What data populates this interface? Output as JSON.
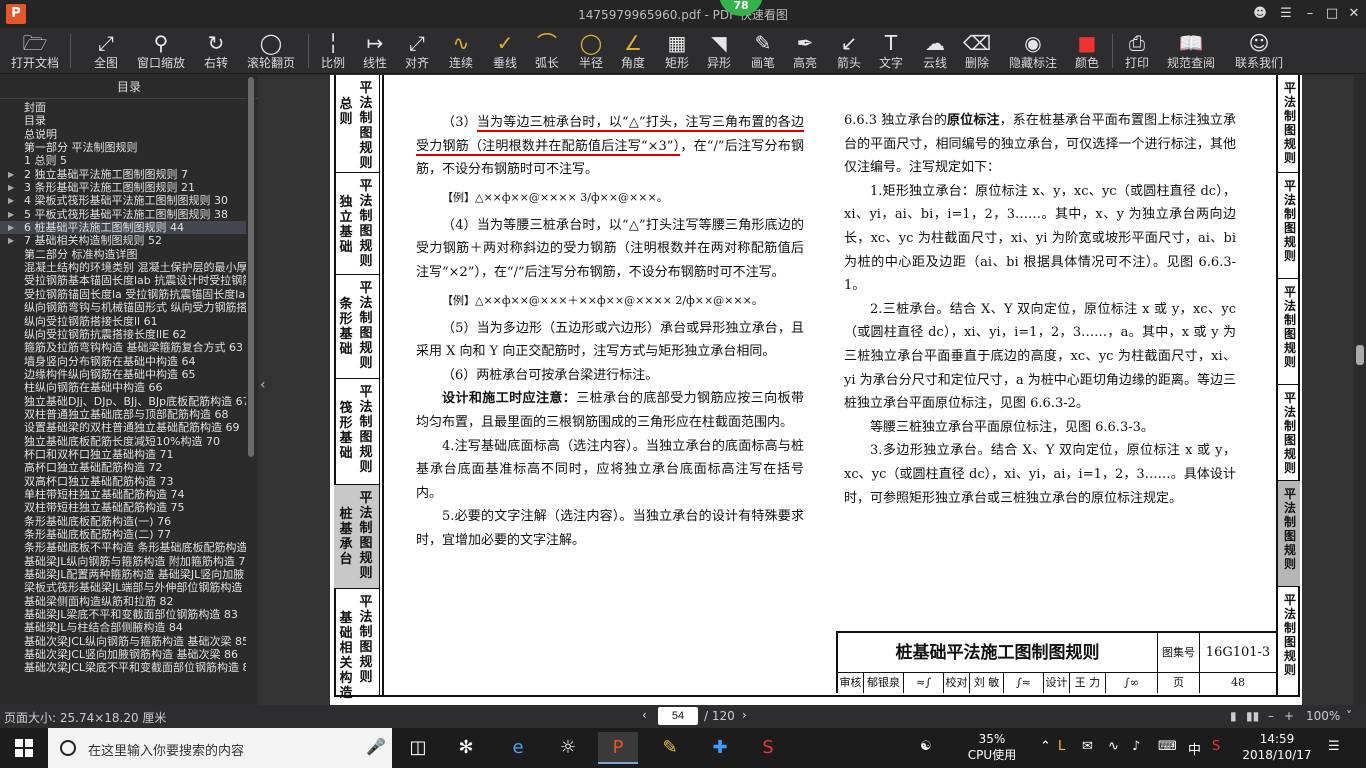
{
  "window": {
    "title": "1475979965960.pdf - PDF 快速看图",
    "badge": "78",
    "logo": "P"
  },
  "toolbar": [
    {
      "label": "打开文档",
      "icon": "folder-icon"
    },
    {
      "label": "全图",
      "icon": "fit-icon"
    },
    {
      "label": "窗口缩放",
      "icon": "zoom-icon"
    },
    {
      "label": "右转",
      "icon": "rotate-icon"
    },
    {
      "label": "滚轮翻页",
      "icon": "mouse-icon"
    },
    {
      "label": "比例",
      "icon": "scale-icon"
    },
    {
      "label": "线性",
      "icon": "linear-icon"
    },
    {
      "label": "对齐",
      "icon": "align-icon"
    },
    {
      "label": "连续",
      "icon": "continuous-icon"
    },
    {
      "label": "垂线",
      "icon": "perpendicular-icon"
    },
    {
      "label": "弧长",
      "icon": "arc-icon"
    },
    {
      "label": "半径",
      "icon": "radius-icon"
    },
    {
      "label": "角度",
      "icon": "angle-icon"
    },
    {
      "label": "矩形",
      "icon": "rectangle-icon"
    },
    {
      "label": "异形",
      "icon": "polygon-icon"
    },
    {
      "label": "画笔",
      "icon": "pen-icon"
    },
    {
      "label": "高亮",
      "icon": "highlight-icon"
    },
    {
      "label": "箭头",
      "icon": "arrow-icon"
    },
    {
      "label": "文字",
      "icon": "text-icon"
    },
    {
      "label": "云线",
      "icon": "cloud-icon"
    },
    {
      "label": "删除",
      "icon": "eraser-icon"
    },
    {
      "label": "隐藏标注",
      "icon": "eye-hide-icon"
    },
    {
      "label": "颜色",
      "icon": "color-icon"
    },
    {
      "label": "打印",
      "icon": "printer-icon"
    },
    {
      "label": "规范查阅",
      "icon": "book-icon"
    },
    {
      "label": "联系我们",
      "icon": "contact-icon"
    }
  ],
  "sidebar": {
    "title": "目录",
    "items": [
      {
        "label": "封面"
      },
      {
        "label": "目录"
      },
      {
        "label": "总说明"
      },
      {
        "label": "第一部分  平法制图规则"
      },
      {
        "label": "1 总则 5"
      },
      {
        "label": "2 独立基础平法施工图制图规则 7",
        "expand": true
      },
      {
        "label": "3 条形基础平法施工图制图规则 21",
        "expand": true
      },
      {
        "label": "4 梁板式筏形基础平法施工图制图规则 30",
        "expand": true
      },
      {
        "label": "5 平板式筏形基础平法施工图制图规则 38",
        "expand": true
      },
      {
        "label": "6 桩基础平法施工图制图规则 44",
        "expand": true,
        "selected": true
      },
      {
        "label": "7 基础相关构造制图规则 52",
        "expand": true
      },
      {
        "label": "第二部分  标准构造详图"
      },
      {
        "label": "混凝土结构的环境类别 混凝土保护层的最小厚度 56"
      },
      {
        "label": "受拉钢筋基本锚固长度lab 抗震设计时受拉钢筋基本锚固长度labE 57"
      },
      {
        "label": "受拉钢筋锚固长度la 受拉钢筋抗震锚固长度laE 58"
      },
      {
        "label": "纵向钢筋弯钩与机械锚固形式 纵向受力钢筋搭接区箍筋构造 59"
      },
      {
        "label": "纵向受拉钢筋搭接长度ll 61"
      },
      {
        "label": "纵向受拉钢筋抗震搭接长度llE 62"
      },
      {
        "label": "箍筋及拉筋弯钩构造 基础梁箍筋复合方式 63"
      },
      {
        "label": "墙身竖向分布钢筋在基础中构造 64"
      },
      {
        "label": "边缘构件纵向钢筋在基础中构造 65"
      },
      {
        "label": "柱纵向钢筋在基础中构造 66"
      },
      {
        "label": "独立基础DJj、DJp、BJj、BJp底板配筋构造 67"
      },
      {
        "label": "双柱普通独立基础底部与顶部配筋构造 68"
      },
      {
        "label": "设置基础梁的双柱普通独立基础配筋构造 69"
      },
      {
        "label": "独立基础底板配筋长度减短10%构造 70"
      },
      {
        "label": "杯口和双杯口独立基础构造 71"
      },
      {
        "label": "高杯口独立基础配筋构造 72"
      },
      {
        "label": "双高杯口独立基础配筋构造 73"
      },
      {
        "label": "单柱带短柱独立基础配筋构造 74"
      },
      {
        "label": "双柱带短柱独立基础配筋构造 75"
      },
      {
        "label": "条形基础底板配筋构造(一) 76"
      },
      {
        "label": "条形基础底板配筋构造(二) 77"
      },
      {
        "label": "条形基础底板不平构造 条形基础底板配筋构造 78"
      },
      {
        "label": "基础梁JL纵向钢筋与箍筋构造 附加箍筋构造 79"
      },
      {
        "label": "基础梁JL配置两种箍筋构造 基础梁JL竖向加腋 80"
      },
      {
        "label": "梁板式筏形基础梁JL端部与外伸部位钢筋构造 81"
      },
      {
        "label": "基础梁侧面构造纵筋和拉筋 82"
      },
      {
        "label": "基础梁JL梁底不平和变截面部位钢筋构造 83"
      },
      {
        "label": "基础梁JL与柱结合部侧腋构造 84"
      },
      {
        "label": "基础次梁JCL纵向钢筋与箍筋构造 基础次梁 85"
      },
      {
        "label": "基础次梁JCL竖向加腋钢筋构造 基础次梁 86"
      },
      {
        "label": "基础次梁JCL梁底不平和变截面部位钢筋构造 87"
      }
    ]
  },
  "page": {
    "left_tabs": [
      {
        "col1": "总则",
        "col2": "平法制图规则"
      },
      {
        "col1": "独立基础",
        "col2": "平法制图规则"
      },
      {
        "col1": "条形基础",
        "col2": "平法制图规则"
      },
      {
        "col1": "筏形基础",
        "col2": "平法制图规则"
      },
      {
        "col1": "桩基承台",
        "col2": "平法制图规则"
      },
      {
        "col1": "基础相关构造",
        "col2": "平法制图规则"
      }
    ],
    "right_tabs": [
      "平法制图规则",
      "平法制图规则",
      "平法制图规则",
      "平法制图规则",
      "平法制图规则",
      "平法制图规则"
    ],
    "left": {
      "p1_a": "（3）",
      "p1_u1": "当为等边三桩承台时，以“△”打头，注写三角布",
      "p1_u2": "置的各边受力钢筋（注明根数并在配筋值后注写“×3”）",
      "p1_b": "，在“/”后注写分布钢筋，不设分布钢筋时可不注写。",
      "ex1": "【例】△××ф××@×××× 3/ф××@×××。",
      "p2": "（4）当为等腰三桩承台时，以“△”打头注写等腰三角形底边的受力钢筋＋两对称斜边的受力钢筋（注明根数并在两对称配筋值后注写“×2”），在“/”后注写分布钢筋，不设分布钢筋时可不注写。",
      "ex2": "【例】△××ф××@×××＋××ф××@×××× 2/ф××@×××。",
      "p3": "（5）当为多边形（五边形或六边形）承台或异形独立承台，且采用 X 向和 Y 向正交配筋时，注写方式与矩形独立承台相同。",
      "p4": "（6）两桩承台可按承台梁进行标注。",
      "p5_bold": "设计和施工时应注意：",
      "p5": "三桩承台的底部受力钢筋应按三向板带均匀布置，且最里面的三根钢筋围成的三角形应在柱截面范围内。",
      "p6": "4.注写基础底面标高（选注内容）。当独立承台的底面标高与桩基承台底面基准标高不同时，应将独立承台底面标高注写在括号内。",
      "p7": "5.必要的文字注解（选注内容）。当独立承台的设计有特殊要求时，宜增加必要的文字注解。"
    },
    "right": {
      "p1_a": "6.6.3 独立承台的",
      "p1_bold": "原位标注",
      "p1_b": "，系在桩基承台平面布置图上标注独立承台的平面尺寸，相同编号的独立承台，可仅选择一个进行标注，其他仅注编号。注写规定如下：",
      "p2": "1.矩形独立承台：原位标注 x、y，xc、yc（或圆柱直径 dc），xi、yi，ai、bi，i=1，2，3……。其中，x、y 为独立承台两向边长，xc、yc 为柱截面尺寸，xi、yi 为阶宽或坡形平面尺寸，ai、bi 为桩的中心距及边距（ai、bi 根据具体情况可不注）。见图 6.6.3-1。",
      "p3": "2.三桩承台。结合 X、Y 双向定位，原位标注 x 或 y，xc、yc（或圆柱直径 dc），xi、yi，i=1，2，3……，a。其中，x 或 y 为三桩独立承台平面垂直于底边的高度，xc、yc 为柱截面尺寸，xi、yi 为承台分尺寸和定位尺寸，a 为桩中心距切角边缘的距离。等边三桩独立承台平面原位标注，见图 6.6.3-2。",
      "p4": "等腰三桩独立承台平面原位标注，见图 6.6.3-3。",
      "p5": "3.多边形独立承台。结合 X、Y 双向定位，原位标注 x 或 y，xc、yc（或圆柱直径 dc），xi、yi，ai，i=1，2，3……。具体设计时，可参照矩形独立承台或三桩独立承台的原位标注规定。"
    },
    "titleblock": {
      "title": "桩基础平法施工图制图规则",
      "atlas_label": "图集号",
      "atlas_no": "16G101-3",
      "review_label": "审核",
      "reviewer": "郁银泉",
      "proof_label": "校对",
      "proofer": "刘 敏",
      "design_label": "设计",
      "designer": "王 力",
      "page_label": "页",
      "page_no": "48"
    }
  },
  "status": {
    "page_size": "页面大小: 25.74×18.20 厘米",
    "current_page": "54",
    "total_pages": "/ 120",
    "zoom": "100%"
  },
  "taskbar": {
    "search_placeholder": "在这里输入你要搜索的内容",
    "cpu_percent": "35%",
    "cpu_label": "CPU使用",
    "ime": "中",
    "time": "14:59",
    "date": "2018/10/17"
  }
}
